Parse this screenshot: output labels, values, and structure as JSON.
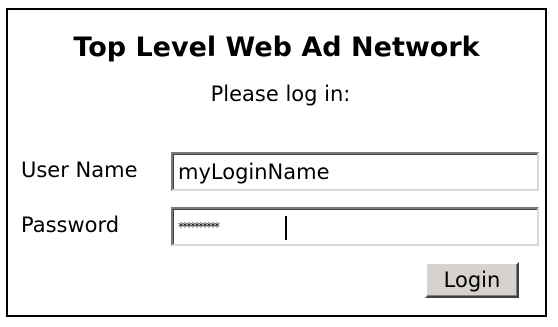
{
  "login_form": {
    "title": "Top Level Web Ad Network",
    "prompt": "Please log in:",
    "username_label": "User Name",
    "username_value": "myLoginName",
    "password_label": "Password",
    "password_value": "**********",
    "login_button_label": "Login"
  }
}
